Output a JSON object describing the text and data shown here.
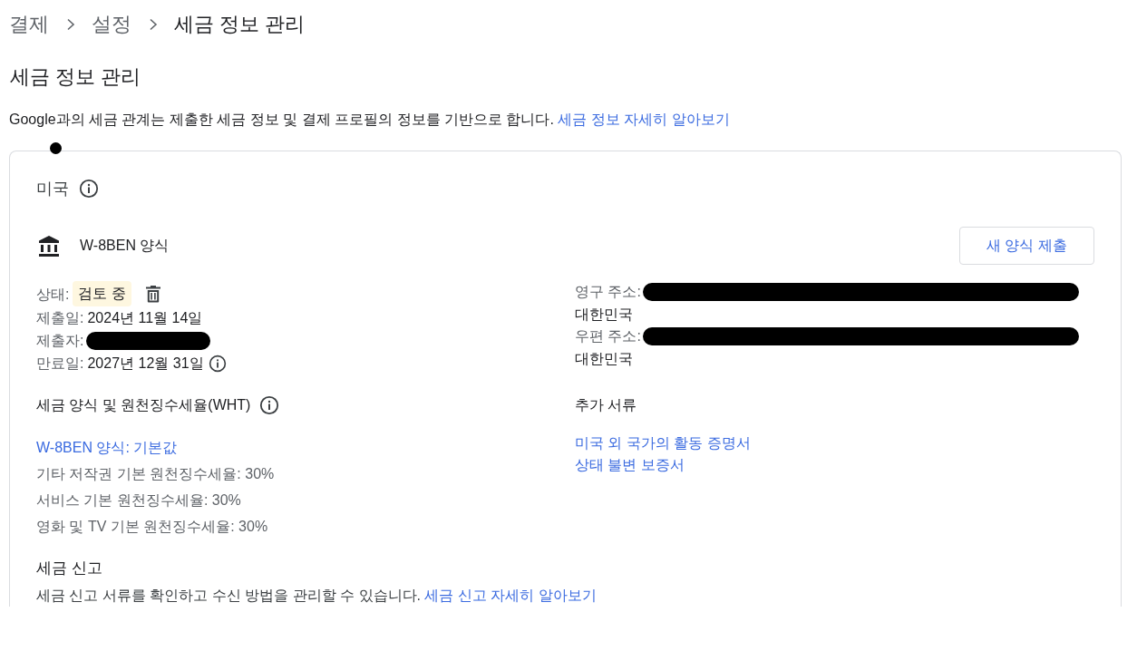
{
  "breadcrumb": [
    {
      "label": "결제",
      "current": false
    },
    {
      "label": "설정",
      "current": false
    },
    {
      "label": "세금 정보 관리",
      "current": true
    }
  ],
  "page_title": "세금 정보 관리",
  "intro": {
    "text": "Google과의 세금 관계는 제출한 세금 정보 및 결제 프로필의 정보를 기반으로 합니다.",
    "link": "세금 정보 자세히 알아보기"
  },
  "card": {
    "country": "미국",
    "form": {
      "title": "W-8BEN 양식",
      "submit_button": "새 양식 제출",
      "details": [
        {
          "kind": "status",
          "label": "상태:",
          "value": "검토 중"
        },
        {
          "kind": "text",
          "label": "제출일:",
          "value": "2024년 11월 14일"
        },
        {
          "kind": "redacted",
          "label": "제출자:"
        },
        {
          "kind": "expiry",
          "label": "만료일:",
          "value": "2027년 12월 31일"
        }
      ],
      "addresses": [
        {
          "label": "영구 주소:",
          "redacted": true,
          "country": "대한민국"
        },
        {
          "label": "우편 주소:",
          "redacted": true,
          "country": "대한민국"
        }
      ]
    },
    "withholding": {
      "title": "세금 양식 및 원천징수세율(WHT)",
      "link": "W-8BEN 양식: 기본값",
      "rates": [
        "기타 저작권 기본 원천징수세율: 30%",
        "서비스 기본 원천징수세율: 30%",
        "영화 및 TV 기본 원천징수세율: 30%"
      ]
    },
    "additional_documents": {
      "title": "추가 서류",
      "links": [
        "미국 외 국가의 활동 증명서",
        "상태 불변 보증서"
      ]
    },
    "tax_reporting": {
      "title": "세금 신고",
      "text": "세금 신고 서류를 확인하고 수신 방법을 관리할 수 있습니다.",
      "link": "세금 신고 자세히 알아보기"
    }
  }
}
